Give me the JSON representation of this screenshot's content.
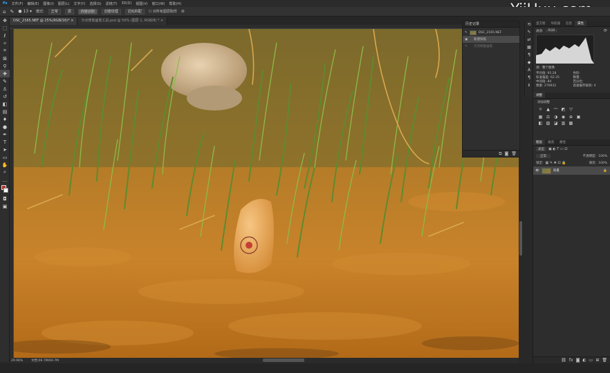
{
  "menubar": [
    "文件(F)",
    "编辑(E)",
    "图像(I)",
    "图层(L)",
    "文字(Y)",
    "选择(S)",
    "滤镜(T)",
    "3D(D)",
    "视图(V)",
    "窗口(W)",
    "帮助(H)"
  ],
  "options": {
    "mode_label": "模式:",
    "mode_value": "正常",
    "source_btn": "源",
    "content_aware": "内容识别",
    "create_texture": "创建纹理",
    "proximity": "近似匹配",
    "sample_all": "对所有图层取样"
  },
  "tabs": [
    {
      "label": "DSC_2165.NEF @ 25%(RGB/16)*",
      "active": true
    },
    {
      "label": "污点修复画笔工具.psd @ 50% (图层 1, RGB/8) *",
      "active": false
    }
  ],
  "tools": [
    "move-tool",
    "marquee-tool",
    "lasso-tool",
    "quick-select-tool",
    "crop-tool",
    "frame-tool",
    "eyedropper-tool",
    "spot-healing-tool",
    "brush-tool",
    "clone-stamp-tool",
    "history-brush-tool",
    "eraser-tool",
    "gradient-tool",
    "blur-tool",
    "dodge-tool",
    "pen-tool",
    "type-tool",
    "path-select-tool",
    "shape-tool",
    "hand-tool",
    "zoom-tool",
    "more-tools"
  ],
  "status": {
    "zoom": "29.96%",
    "doc": "文档:69.7M/69.7M"
  },
  "history_panel": {
    "title": "历史记录",
    "snapshot": "DSC_2165.NEF",
    "rows": [
      {
        "label": "新建快照",
        "state": "sel"
      },
      {
        "label": "污点修复画笔",
        "state": "dim"
      }
    ]
  },
  "right_panel": {
    "tabs1": [
      "直方图",
      "导航器",
      "信息",
      "属性"
    ],
    "channel_label": "通道:",
    "channel_value": "RGB",
    "source_label": "源:",
    "source_value": "整个图像",
    "stats": [
      {
        "k": "平均值:",
        "v": "95.28"
      },
      {
        "k": "标准偏差:",
        "v": "62.35"
      },
      {
        "k": "中间值:",
        "v": "84"
      },
      {
        "k": "像素:",
        "v": "276932"
      },
      {
        "k": "色阶:",
        "v": ""
      },
      {
        "k": "数量:",
        "v": ""
      },
      {
        "k": "百分位:",
        "v": ""
      },
      {
        "k": "高速缓存级别:",
        "v": "4"
      }
    ],
    "adjust_title": "调整",
    "adjust_sub": "添加调整",
    "layer_tabs": [
      "图层",
      "通道",
      "路径"
    ],
    "layer_kind": "类型",
    "layer_mode": "正常",
    "opacity_label": "不透明度:",
    "opacity_value": "100%",
    "lock_label": "锁定:",
    "fill_label": "填充:",
    "fill_value": "100%",
    "layer_name": "背景"
  },
  "watermark": "YiiHuu.com"
}
